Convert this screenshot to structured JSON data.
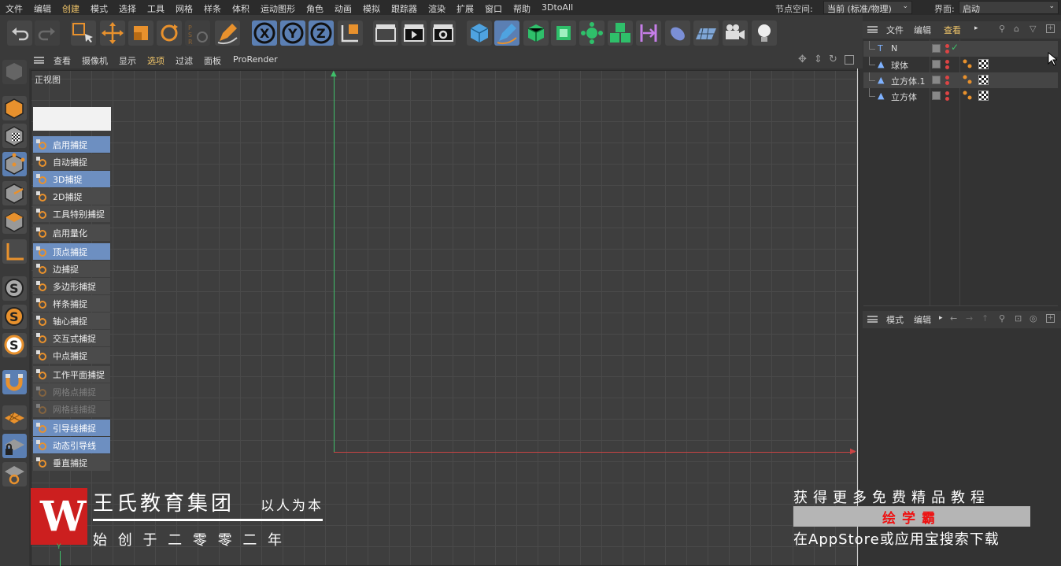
{
  "menubar": {
    "items": [
      "文件",
      "编辑",
      "创建",
      "模式",
      "选择",
      "工具",
      "网格",
      "样条",
      "体积",
      "运动图形",
      "角色",
      "动画",
      "模拟",
      "跟踪器",
      "渲染",
      "扩展",
      "窗口",
      "帮助",
      "3DtoAll"
    ],
    "node_space_label": "节点空间:",
    "node_space_value": "当前 (标准/物理)",
    "interface_label": "界面:",
    "interface_value": "启动"
  },
  "viewport": {
    "menu": [
      "查看",
      "摄像机",
      "显示",
      "选项",
      "过滤",
      "面板",
      "ProRender"
    ],
    "active_menu": "选项",
    "label": "正视图"
  },
  "snap_menu": {
    "items": [
      {
        "label": "启用捕捉",
        "state": "active"
      },
      {
        "label": "自动捕捉",
        "state": "normal"
      },
      {
        "label": "3D捕捉",
        "state": "active"
      },
      {
        "label": "2D捕捉",
        "state": "normal"
      },
      {
        "label": "工具特别捕捉",
        "state": "normal"
      },
      {
        "label": "启用量化",
        "state": "normal"
      },
      {
        "label": "顶点捕捉",
        "state": "active"
      },
      {
        "label": "边捕捉",
        "state": "normal"
      },
      {
        "label": "多边形捕捉",
        "state": "normal"
      },
      {
        "label": "样条捕捉",
        "state": "normal"
      },
      {
        "label": "轴心捕捉",
        "state": "normal"
      },
      {
        "label": "交互式捕捉",
        "state": "normal"
      },
      {
        "label": "中点捕捉",
        "state": "normal"
      },
      {
        "label": "工作平面捕捉",
        "state": "normal"
      },
      {
        "label": "网格点捕捉",
        "state": "disabled"
      },
      {
        "label": "网格线捕捉",
        "state": "disabled"
      },
      {
        "label": "引导线捕捉",
        "state": "active"
      },
      {
        "label": "动态引导线",
        "state": "active"
      },
      {
        "label": "垂直捕捉",
        "state": "normal"
      }
    ]
  },
  "object_manager": {
    "header": [
      "文件",
      "编辑",
      "查看"
    ],
    "objects": [
      {
        "name": "N",
        "icon": "text-spline-icon"
      },
      {
        "name": "球体",
        "icon": "sphere-object-icon"
      },
      {
        "name": "立方体.1",
        "icon": "cube-object-icon"
      },
      {
        "name": "立方体",
        "icon": "cube-object-icon"
      }
    ]
  },
  "attribute_manager": {
    "header": [
      "模式",
      "编辑"
    ]
  },
  "watermark": {
    "company": "王氏教育集团",
    "slogan": "以人为本",
    "founded": "始 创 于 二 零 零 二 年",
    "logo_letter": "W",
    "axis_y": "Y"
  },
  "promo": {
    "line1": "获得更多免费精品教程",
    "line2": "绘学霸",
    "line3": "在AppStore或应用宝搜索下载"
  },
  "colors": {
    "active_blue": "#6d8fc1",
    "axis_green": "#3fbf6a",
    "axis_red": "#c94444",
    "brand_red": "#cc1f1f",
    "tool_orange": "#e8912d"
  }
}
